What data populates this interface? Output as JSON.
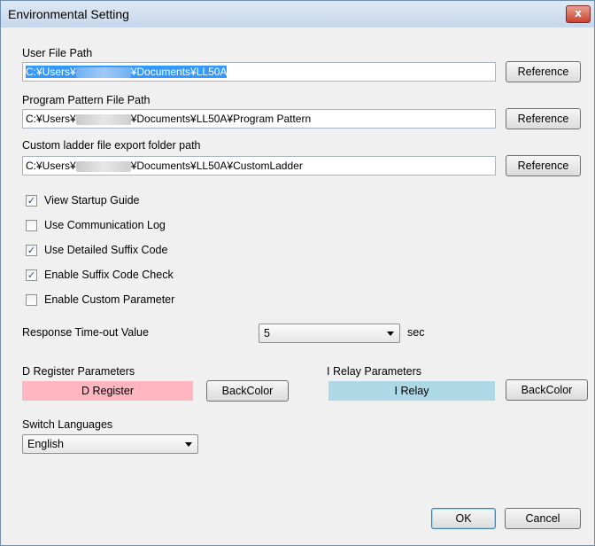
{
  "window": {
    "title": "Environmental Setting",
    "close_label": "x"
  },
  "user_file_path": {
    "label": "User File Path",
    "value_prefix": "C:¥Users¥",
    "value_suffix": "¥Documents¥LL50A",
    "button": "Reference"
  },
  "program_pattern_path": {
    "label": "Program Pattern File Path",
    "value_prefix": "C:¥Users¥",
    "value_suffix": "¥Documents¥LL50A¥Program Pattern",
    "button": "Reference"
  },
  "custom_ladder_path": {
    "label": "Custom ladder file export folder path",
    "value_prefix": "C:¥Users¥",
    "value_suffix": "¥Documents¥LL50A¥CustomLadder",
    "button": "Reference"
  },
  "checkboxes": [
    {
      "label": "View Startup Guide",
      "checked": true
    },
    {
      "label": "Use Communication Log",
      "checked": false
    },
    {
      "label": "Use Detailed Suffix Code",
      "checked": true
    },
    {
      "label": "Enable Suffix Code Check",
      "checked": true
    },
    {
      "label": "Enable Custom Parameter",
      "checked": false
    }
  ],
  "response_timeout": {
    "label": "Response Time-out Value",
    "value": "5",
    "unit": "sec"
  },
  "d_register": {
    "label": "D Register Parameters",
    "sample": "D Register",
    "button": "BackColor",
    "color": "#ffb6c1"
  },
  "i_relay": {
    "label": "I Relay Parameters",
    "sample": "I Relay",
    "button": "BackColor",
    "color": "#add8e6"
  },
  "switch_languages": {
    "label": "Switch Languages",
    "value": "English"
  },
  "footer": {
    "ok": "OK",
    "cancel": "Cancel"
  },
  "check_glyph": "✓"
}
